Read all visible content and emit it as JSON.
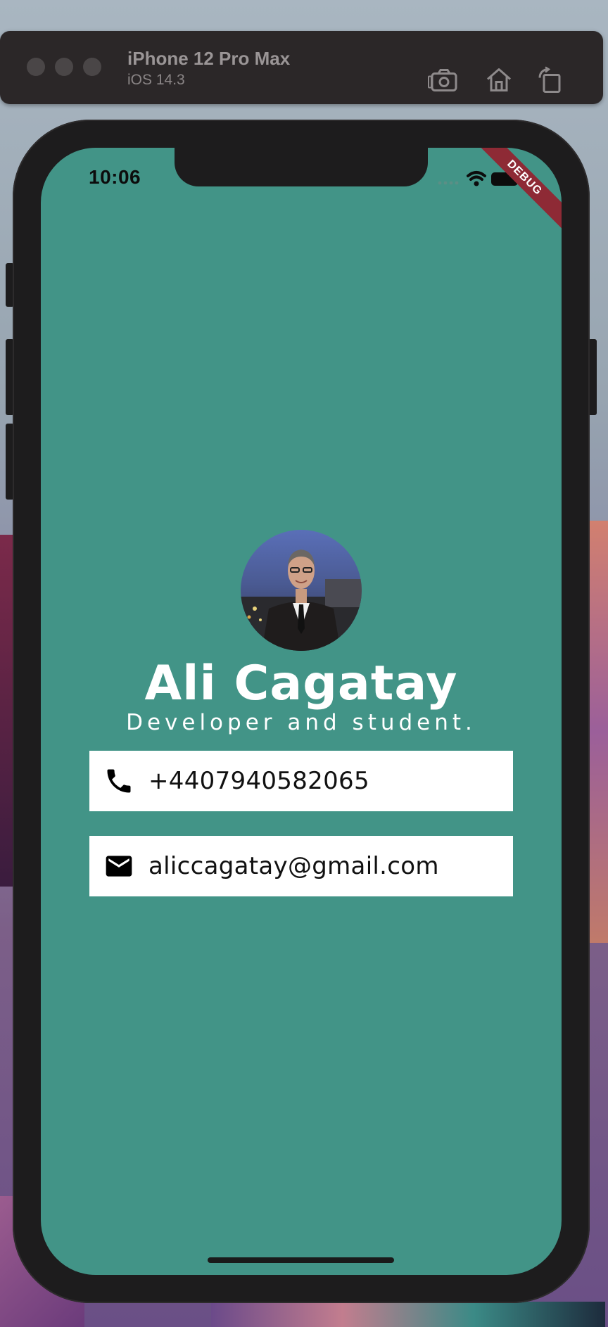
{
  "simulator": {
    "device_name": "iPhone 12 Pro Max",
    "os_version": "iOS 14.3",
    "toolbar_icons": [
      "screenshot-icon",
      "home-icon",
      "rotate-icon"
    ]
  },
  "status_bar": {
    "time": "10:06",
    "icons": [
      "cellular-signal-icon",
      "wifi-icon",
      "battery-icon"
    ]
  },
  "debug_banner": "DEBUG",
  "profile": {
    "name": "Ali Cagatay",
    "subtitle": "Developer and student.",
    "background_color": "#429487"
  },
  "contact_cards": [
    {
      "icon": "phone-icon",
      "text": "+4407940582065"
    },
    {
      "icon": "mail-icon",
      "text": "aliccagatay@gmail.com"
    }
  ]
}
